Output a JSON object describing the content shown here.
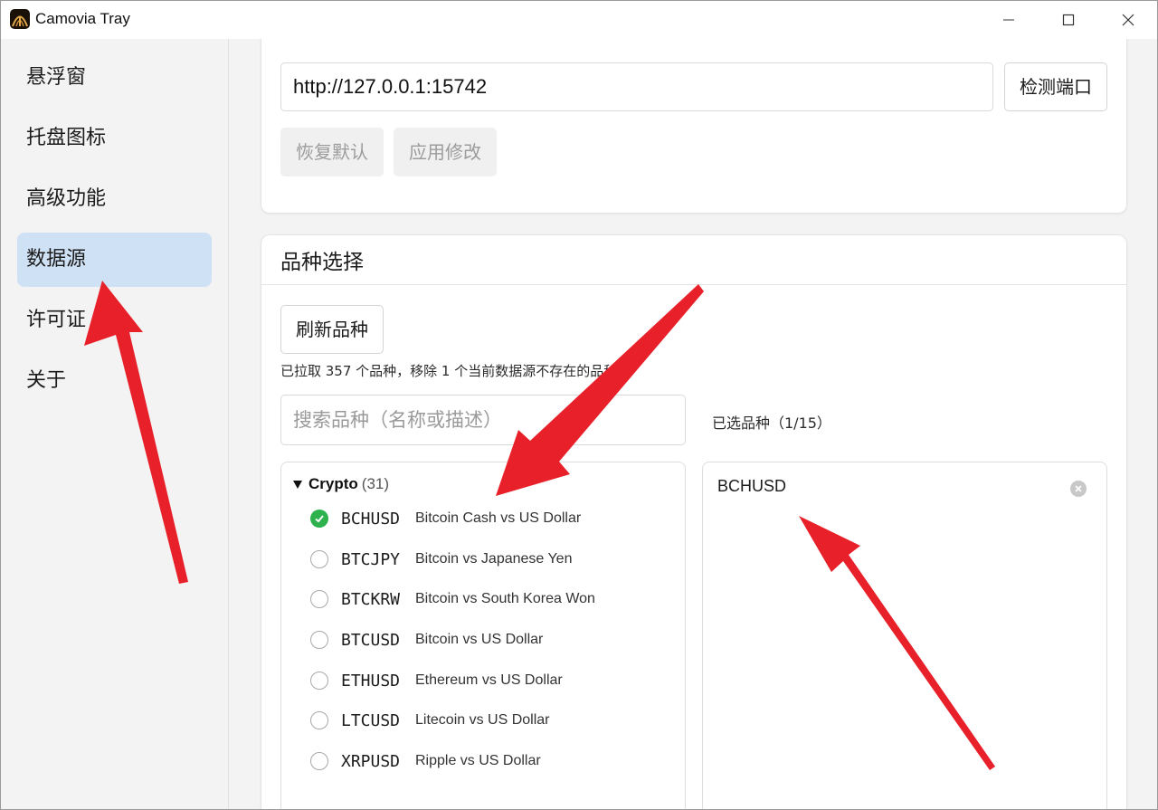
{
  "window": {
    "title": "Camovia Tray"
  },
  "sidebar": {
    "items": [
      {
        "label": "悬浮窗"
      },
      {
        "label": "托盘图标"
      },
      {
        "label": "高级功能"
      },
      {
        "label": "数据源",
        "active": true
      },
      {
        "label": "许可证"
      },
      {
        "label": "关于"
      }
    ]
  },
  "connection": {
    "url_value": "http://127.0.0.1:15742",
    "detect_button": "检测端口",
    "restore_button": "恢复默认",
    "apply_button": "应用修改"
  },
  "symbols": {
    "section_title": "品种选择",
    "refresh_button": "刷新品种",
    "status_text": "已拉取 357 个品种，移除 1 个当前数据源不存在的品种",
    "search_placeholder": "搜索品种（名称或描述）",
    "selected_label": "已选品种（1/15）",
    "group": {
      "name": "Crypto",
      "count": "(31)",
      "expanded": true
    },
    "items": [
      {
        "symbol": "BCHUSD",
        "desc": "Bitcoin Cash vs US Dollar",
        "checked": true
      },
      {
        "symbol": "BTCJPY",
        "desc": "Bitcoin vs Japanese Yen",
        "checked": false
      },
      {
        "symbol": "BTCKRW",
        "desc": "Bitcoin vs South Korea Won",
        "checked": false
      },
      {
        "symbol": "BTCUSD",
        "desc": "Bitcoin vs US Dollar",
        "checked": false
      },
      {
        "symbol": "ETHUSD",
        "desc": "Ethereum vs US Dollar",
        "checked": false
      },
      {
        "symbol": "LTCUSD",
        "desc": "Litecoin vs US Dollar",
        "checked": false
      },
      {
        "symbol": "XRPUSD",
        "desc": "Ripple vs US Dollar",
        "checked": false
      }
    ],
    "selected": [
      {
        "symbol": "BCHUSD"
      }
    ]
  },
  "colors": {
    "active_nav": "#cfe1f4",
    "check_green": "#2db24e",
    "annotation_arrow": "#e8202a"
  },
  "icons": {
    "app": "camovia-app-icon",
    "minimize": "minimize-icon",
    "maximize": "maximize-icon",
    "close": "close-icon",
    "expand": "triangle-down-icon",
    "check": "check-icon",
    "remove": "remove-chip-icon"
  }
}
